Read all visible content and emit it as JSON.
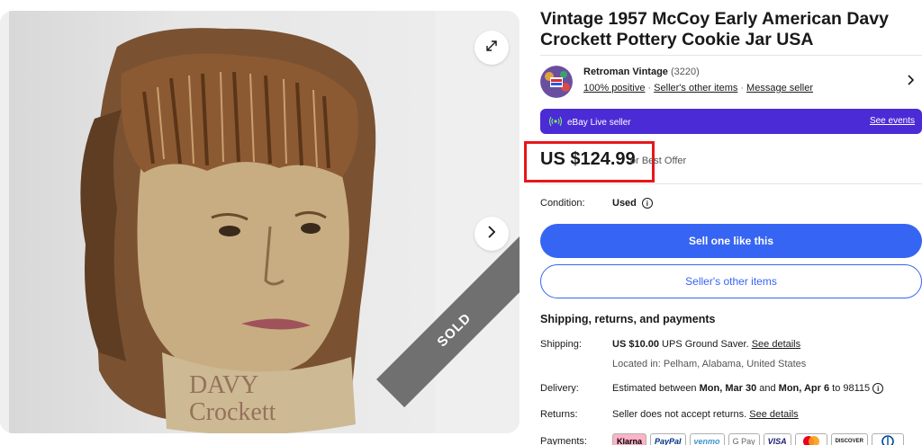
{
  "listing": {
    "title": "Vintage 1957 McCoy Early American Davy Crockett Pottery Cookie Jar USA",
    "sold_badge": "SOLD",
    "jar_text": "DAVY Crockett"
  },
  "seller": {
    "name": "Retroman Vintage",
    "feedback_count": "(3220)",
    "positive": "100% positive",
    "other_items": "Seller's other items",
    "message": "Message seller"
  },
  "live": {
    "label": "eBay Live seller",
    "events": "See events"
  },
  "price": {
    "amount": "US $124.99",
    "best_offer": "or Best Offer"
  },
  "condition": {
    "label": "Condition:",
    "value": "Used"
  },
  "buttons": {
    "sell_one": "Sell one like this",
    "other_items": "Seller's other items"
  },
  "shipping": {
    "heading": "Shipping, returns, and payments",
    "ship_label": "Shipping:",
    "ship_cost": "US $10.00",
    "ship_method": " UPS Ground Saver. ",
    "ship_details": "See details",
    "location": "Located in: Pelham, Alabama, United States",
    "delivery_label": "Delivery:",
    "delivery_pre": "Estimated between ",
    "delivery_start": "Mon, Mar 30",
    "delivery_mid": " and ",
    "delivery_end": "Mon, Apr 6",
    "delivery_post": " to 98115",
    "returns_label": "Returns:",
    "returns_text": "Seller does not accept returns. ",
    "returns_details": "See details",
    "payments_label": "Payments:",
    "payment_methods": [
      "Klarna",
      "PayPal",
      "venmo",
      "G Pay",
      "VISA",
      "",
      "DISCOVER",
      ""
    ]
  },
  "colors": {
    "primary": "#3665f3",
    "live_purple": "#4b2bd6",
    "highlight_red": "#e8161a",
    "sold_ribbon": "#707070"
  }
}
